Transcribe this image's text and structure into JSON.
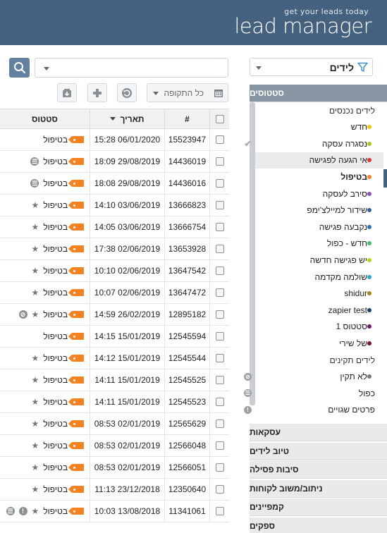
{
  "header": {
    "tagline": "get your leads today",
    "brand": "lead manager",
    "bg_color": "#44617f"
  },
  "toolbar": {
    "search_placeholder": "",
    "period_label": "כל התקופה",
    "buttons": [
      "refresh-icon",
      "add-icon",
      "export-icon"
    ]
  },
  "table": {
    "columns": [
      "#",
      "תאריך",
      "סטטוס"
    ],
    "tag_color": "#f58220",
    "rows": [
      {
        "id": "15523947",
        "date": "15:28 06/01/2020",
        "status": "בטיפול",
        "extra": []
      },
      {
        "id": "14436019",
        "date": "18:09 29/08/2019",
        "status": "בטיפול",
        "extra": [
          "duplicate"
        ]
      },
      {
        "id": "14436016",
        "date": "18:08 29/08/2019",
        "status": "בטיפול",
        "extra": [
          "duplicate"
        ]
      },
      {
        "id": "13666823",
        "date": "14:10 03/06/2019",
        "status": "בטיפול",
        "extra": [
          "star"
        ]
      },
      {
        "id": "13666754",
        "date": "14:05 03/06/2019",
        "status": "בטיפול",
        "extra": [
          "star"
        ]
      },
      {
        "id": "13653928",
        "date": "17:38 02/06/2019",
        "status": "בטיפול",
        "extra": [
          "star"
        ]
      },
      {
        "id": "13647542",
        "date": "10:10 02/06/2019",
        "status": "בטיפול",
        "extra": [
          "star"
        ]
      },
      {
        "id": "13647472",
        "date": "10:07 02/06/2019",
        "status": "בטיפול",
        "extra": [
          "star"
        ]
      },
      {
        "id": "12895182",
        "date": "14:59 26/02/2019",
        "status": "בטיפול",
        "extra": [
          "star",
          "invalid"
        ]
      },
      {
        "id": "12545594",
        "date": "14:15 15/01/2019",
        "status": "בטיפול",
        "extra": []
      },
      {
        "id": "12545544",
        "date": "14:12 15/01/2019",
        "status": "בטיפול",
        "extra": [
          "star"
        ]
      },
      {
        "id": "12545525",
        "date": "14:11 15/01/2019",
        "status": "בטיפול",
        "extra": [
          "star"
        ]
      },
      {
        "id": "12545523",
        "date": "14:11 15/01/2019",
        "status": "בטיפול",
        "extra": [
          "star"
        ]
      },
      {
        "id": "12565629",
        "date": "08:53 02/01/2019",
        "status": "בטיפול",
        "extra": [
          "star"
        ]
      },
      {
        "id": "12566048",
        "date": "08:53 02/01/2019",
        "status": "בטיפול",
        "extra": [
          "star"
        ]
      },
      {
        "id": "12566051",
        "date": "08:53 02/01/2019",
        "status": "בטיפול",
        "extra": [
          "star"
        ]
      },
      {
        "id": "12350640",
        "date": "11:13 23/12/2018",
        "status": "בטיפול",
        "extra": [
          "star"
        ]
      },
      {
        "id": "11341061",
        "date": "10:03 13/08/2018",
        "status": "בטיפול",
        "extra": [
          "star",
          "error",
          "duplicate"
        ]
      }
    ]
  },
  "sidebar": {
    "type_select": "לידים",
    "active_section": "סטטוסים",
    "statuses": [
      {
        "label": "לידים נכנסים",
        "dot": "",
        "group": true
      },
      {
        "label": "חדש",
        "dot": "#f2c400"
      },
      {
        "label": "נסגרה עסקה",
        "dot": "#a8c81e",
        "icon": "check"
      },
      {
        "label": "אי הגעה לפגישה",
        "dot": "#e8322b",
        "highlight": true
      },
      {
        "label": "בטיפול",
        "dot": "#f58220",
        "bold": true,
        "active": true
      },
      {
        "label": "סירב לעסקה",
        "dot": "#8a55b7"
      },
      {
        "label": "שידור למיילצ'ימפ",
        "dot": "#2f5f9e"
      },
      {
        "label": "נקבעה פגישה",
        "dot": "#2c6fb8"
      },
      {
        "label": "חדש - כפול",
        "dot": "#3cc36b"
      },
      {
        "label": "יש פגישה חדשה",
        "dot": "#b8d415"
      },
      {
        "label": "שולמה מקדמה",
        "dot": "#2aa7d6"
      },
      {
        "label": "shidur",
        "dot": "#9a8c1a"
      },
      {
        "label": "zapier test",
        "dot": "#1e3f6e"
      },
      {
        "label": "סטטוס 1",
        "dot": "#6a1f6e"
      },
      {
        "label": "של שירי",
        "dot": "#7c1230"
      },
      {
        "label": "לידים תקינים",
        "dot": "",
        "group": true
      },
      {
        "label": "לא תקין",
        "dot": "#777",
        "icon": "invalid"
      },
      {
        "label": "כפול",
        "dot": "",
        "icon": "duplicate"
      },
      {
        "label": "פרטים שגויים",
        "dot": "",
        "icon": "error"
      }
    ],
    "sections": [
      "עסקאות",
      "טיוב לידים",
      "סיבות פסילה",
      "ניתוב/משוב לקוחות",
      "קמפיינים",
      "ספקים"
    ]
  }
}
